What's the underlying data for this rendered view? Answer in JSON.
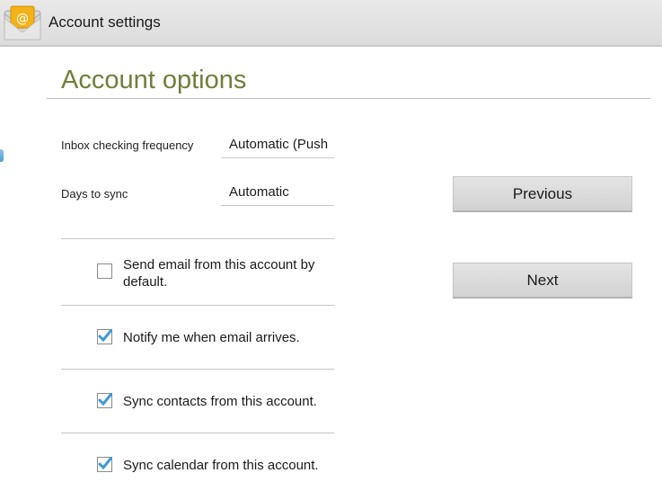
{
  "actionbar": {
    "title": "Account settings",
    "app_icon": "email-app-icon"
  },
  "section": {
    "title": "Account options"
  },
  "fields": {
    "inbox_frequency": {
      "label": "Inbox checking frequency",
      "value": "Automatic (Push"
    },
    "days_to_sync": {
      "label": "Days to sync",
      "value": "Automatic"
    }
  },
  "options": [
    {
      "label": "Send email from this account by default.",
      "checked": false
    },
    {
      "label": "Notify me when email arrives.",
      "checked": true
    },
    {
      "label": "Sync contacts from this account.",
      "checked": true
    },
    {
      "label": "Sync calendar from this account.",
      "checked": true
    }
  ],
  "buttons": {
    "previous": "Previous",
    "next": "Next"
  },
  "colors": {
    "accent_title": "#6f7f3a",
    "checkbox_check": "#3a9ad9",
    "actionbar_bg": "#e0e0e0"
  }
}
